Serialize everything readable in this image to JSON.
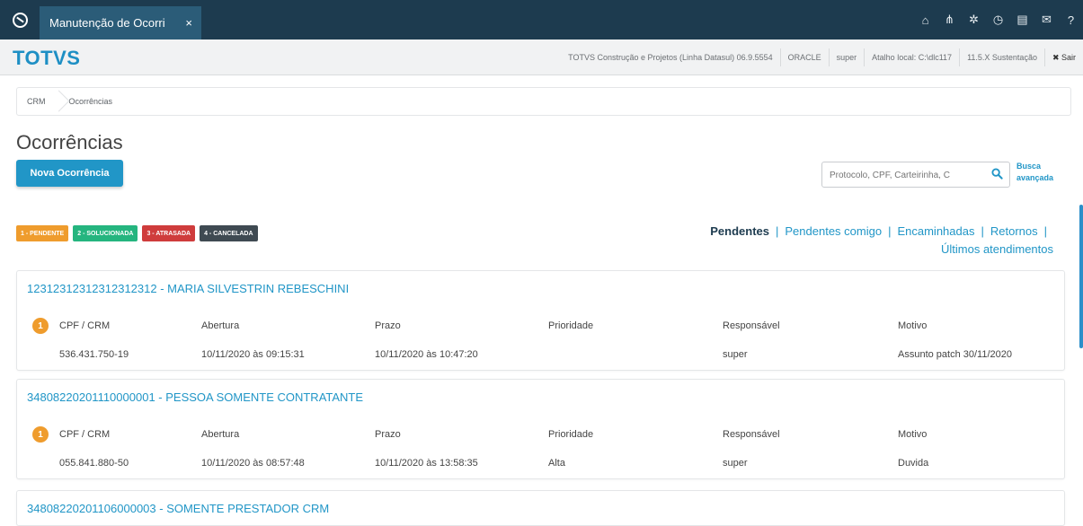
{
  "topbar": {
    "tab_label": "Manutenção de Ocorri",
    "tab_close": "×",
    "icons": [
      "home-icon",
      "sitemap-icon",
      "gear-icon",
      "clock-icon",
      "document-icon",
      "mail-icon",
      "help-icon"
    ],
    "icon_glyphs": [
      "⌂",
      "⋔",
      "✲",
      "◷",
      "▤",
      "✉",
      "?"
    ]
  },
  "header": {
    "brand": "TOTVS",
    "product": "TOTVS Construção e Projetos (Linha Datasul) 06.9.5554",
    "database": "ORACLE",
    "user": "super",
    "shortcut": "Atalho local: C:\\dlc117",
    "version": "11.5.X Sustentação",
    "logout": "✖ Sair"
  },
  "breadcrumb": [
    "CRM",
    "Ocorrências"
  ],
  "page": {
    "title": "Ocorrências",
    "new_button": "Nova Ocorrência",
    "search_placeholder": "Protocolo, CPF, Carteirinha, C",
    "advanced_search": [
      "Busca",
      "avançada"
    ]
  },
  "legend": [
    {
      "label": "1 - PENDENTE",
      "color": "#ef9c2d"
    },
    {
      "label": "2 - SOLUCIONADA",
      "color": "#25b57f"
    },
    {
      "label": "3 - ATRASADA",
      "color": "#cf3c3c"
    },
    {
      "label": "4 - CANCELADA",
      "color": "#3f4a52"
    }
  ],
  "filters": [
    {
      "label": "Pendentes",
      "active": true
    },
    {
      "label": "Pendentes comigo",
      "active": false
    },
    {
      "label": "Encaminhadas",
      "active": false
    },
    {
      "label": "Retornos",
      "active": false
    },
    {
      "label": "Últimos atendimentos",
      "active": false
    }
  ],
  "columns": [
    "CPF / CRM",
    "Abertura",
    "Prazo",
    "Prioridade",
    "Responsável",
    "Motivo"
  ],
  "occurrences": [
    {
      "title": "12312312312312312312 - MARIA SILVESTRIN REBESCHINI",
      "status": "1",
      "cpf": "536.431.750-19",
      "abertura": "10/11/2020 às 09:15:31",
      "prazo": "10/11/2020 às 10:47:20",
      "prioridade": "",
      "responsavel": "super",
      "motivo": "Assunto patch 30/11/2020"
    },
    {
      "title": "34808220201110000001 - PESSOA SOMENTE CONTRATANTE",
      "status": "1",
      "cpf": "055.841.880-50",
      "abertura": "10/11/2020 às 08:57:48",
      "prazo": "10/11/2020 às 13:58:35",
      "prioridade": "Alta",
      "responsavel": "super",
      "motivo": "Duvida"
    },
    {
      "title": "34808220201106000003 - SOMENTE PRESTADOR CRM"
    }
  ]
}
